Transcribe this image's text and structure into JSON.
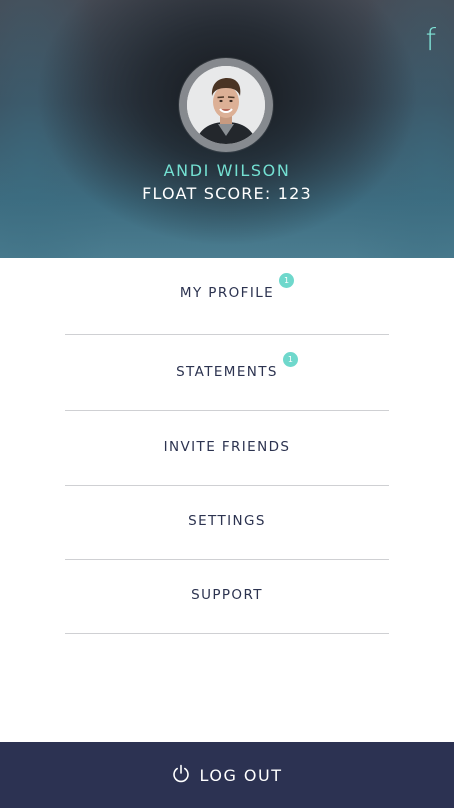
{
  "header": {
    "facebook_icon": "facebook-icon",
    "user_name": "ANDI WILSON",
    "float_score": "FLOAT SCORE: 123",
    "colors": {
      "accent": "#74e0d2",
      "header_top": "#464b55",
      "header_bottom": "#4b7d90"
    }
  },
  "menu": {
    "items": [
      {
        "label": "MY PROFILE",
        "badge": "1"
      },
      {
        "label": "STATEMENTS",
        "badge": "1"
      },
      {
        "label": "INVITE FRIENDS"
      },
      {
        "label": "SETTINGS"
      },
      {
        "label": "SUPPORT"
      }
    ],
    "text_color": "#2c3350",
    "badge_color": "#6fd8cc"
  },
  "footer": {
    "logout_label": "LOG OUT",
    "icon": "power-icon",
    "background": "#2c3252"
  }
}
